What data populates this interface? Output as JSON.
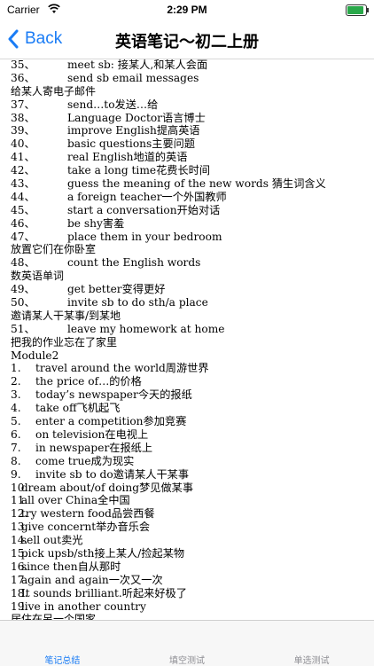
{
  "status": {
    "carrier": "Carrier",
    "time": "2:29 PM"
  },
  "nav": {
    "back_label": "Back",
    "title": "英语笔记～初二上册"
  },
  "lines": [
    {
      "kind": "a",
      "num": "35、",
      "text": "meet sb: 接某人,和某人会面"
    },
    {
      "kind": "a",
      "num": "36、",
      "text": "send sb email messages"
    },
    {
      "kind": "cjk",
      "num": "",
      "text": "给某人寄电子邮件"
    },
    {
      "kind": "a",
      "num": "37、",
      "text": "send…to发送…给"
    },
    {
      "kind": "a",
      "num": "38、",
      "text": "Language Doctor语言博士"
    },
    {
      "kind": "a",
      "num": "39、",
      "text": "improve English提高英语"
    },
    {
      "kind": "a",
      "num": "40、",
      "text": "basic questions主要问题"
    },
    {
      "kind": "a",
      "num": "41、",
      "text": "real English地道的英语"
    },
    {
      "kind": "a",
      "num": "42、",
      "text": "take a long time花费长时间"
    },
    {
      "kind": "a",
      "num": "43、",
      "text": "guess the meaning of the new words 猜生词含义"
    },
    {
      "kind": "a",
      "num": "44、",
      "text": "a foreign teacher一个外国教师"
    },
    {
      "kind": "a",
      "num": "45、",
      "text": "start a conversation开始对话"
    },
    {
      "kind": "a",
      "num": "46、",
      "text": "be shy害羞"
    },
    {
      "kind": "a",
      "num": "47、",
      "text": "place them in your bedroom"
    },
    {
      "kind": "cjk",
      "num": "",
      "text": "放置它们在你卧室"
    },
    {
      "kind": "a",
      "num": "48、",
      "text": "count the English words"
    },
    {
      "kind": "cjk",
      "num": "",
      "text": "数英语单词"
    },
    {
      "kind": "a",
      "num": "49、",
      "text": "get better变得更好"
    },
    {
      "kind": "a",
      "num": "50、",
      "text": "invite sb to do sth/a place"
    },
    {
      "kind": "cjk",
      "num": "",
      "text": "邀请某人干某事/到某地"
    },
    {
      "kind": "a",
      "num": "51、",
      "text": "leave my homework at home"
    },
    {
      "kind": "cjk",
      "num": "",
      "text": "把我的作业忘在了家里"
    },
    {
      "kind": "plain",
      "num": "",
      "text": "Module2"
    },
    {
      "kind": "b",
      "num": "1.",
      "text": "travel around the world周游世界"
    },
    {
      "kind": "b",
      "num": "2.",
      "text": "the price of…的价格"
    },
    {
      "kind": "b",
      "num": "3.",
      "text": "today’s newspaper今天的报纸"
    },
    {
      "kind": "b",
      "num": "4.",
      "text": "take off飞机起飞"
    },
    {
      "kind": "b",
      "num": "5.",
      "text": "enter a competition参加竞赛"
    },
    {
      "kind": "b",
      "num": "6.",
      "text": "on television在电视上"
    },
    {
      "kind": "b",
      "num": "7.",
      "text": "in newspaper在报纸上"
    },
    {
      "kind": "b",
      "num": "8.",
      "text": "come true成为现实"
    },
    {
      "kind": "b",
      "num": "9.",
      "text": "invite sb to do邀请某人干某事"
    },
    {
      "kind": "c",
      "num": "10.",
      "text": " dream about/of doing梦见做某事"
    },
    {
      "kind": "c",
      "num": "11.",
      "text": " all over China全中国"
    },
    {
      "kind": "c",
      "num": "12.",
      "text": " try western food品尝西餐"
    },
    {
      "kind": "c",
      "num": "13.",
      "text": " give concernt举办音乐会"
    },
    {
      "kind": "c",
      "num": "14.",
      "text": " sell out卖光"
    },
    {
      "kind": "c",
      "num": "15.",
      "text": " pick upsb/sth接上某人/捡起某物"
    },
    {
      "kind": "c",
      "num": "16.",
      "text": " since then自从那时"
    },
    {
      "kind": "c",
      "num": "17.",
      "text": " again and again一次又一次"
    },
    {
      "kind": "c",
      "num": "18.",
      "text": " It sounds brilliant.听起来好极了"
    },
    {
      "kind": "c",
      "num": "19.",
      "text": " live in another country"
    },
    {
      "kind": "cjk",
      "num": "",
      "text": "居住在另一个国家"
    }
  ],
  "tabs": [
    {
      "label": "笔记总结",
      "active": true
    },
    {
      "label": "填空测试",
      "active": false
    },
    {
      "label": "单选测试",
      "active": false
    }
  ],
  "colors": {
    "accent": "#1a7cf5",
    "inactive_tab": "#8e8e93"
  }
}
